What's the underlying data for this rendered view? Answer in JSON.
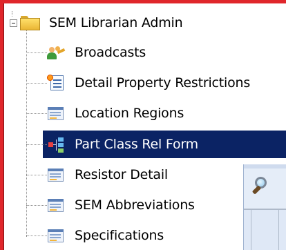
{
  "tree": {
    "root": {
      "label": "SEM Librarian Admin",
      "icon": "folder-icon",
      "expander": "collapse-icon"
    },
    "items": [
      {
        "label": "Broadcasts",
        "icon": "broadcast-users-icon",
        "selected": false
      },
      {
        "label": "Detail Property Restrictions",
        "icon": "document-list-icon",
        "selected": false
      },
      {
        "label": "Location Regions",
        "icon": "form-icon",
        "selected": false
      },
      {
        "label": "Part Class Rel Form",
        "icon": "hierarchy-icon",
        "selected": true
      },
      {
        "label": "Resistor Detail",
        "icon": "form-icon",
        "selected": false
      },
      {
        "label": "SEM Abbreviations",
        "icon": "form-icon",
        "selected": false
      },
      {
        "label": "Specifications",
        "icon": "form-icon",
        "selected": false
      }
    ]
  },
  "colors": {
    "selection": "#0b2364",
    "selection_text": "#ffffff",
    "frame_red": "#e0262b",
    "panel": "#e5edf8"
  },
  "panel": {
    "icon": "search-icon"
  }
}
